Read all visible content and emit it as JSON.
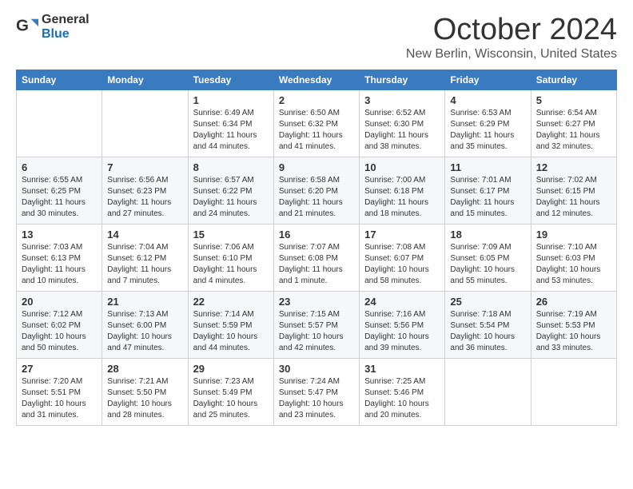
{
  "logo": {
    "general": "General",
    "blue": "Blue"
  },
  "title": "October 2024",
  "subtitle": "New Berlin, Wisconsin, United States",
  "headers": [
    "Sunday",
    "Monday",
    "Tuesday",
    "Wednesday",
    "Thursday",
    "Friday",
    "Saturday"
  ],
  "weeks": [
    [
      {
        "day": "",
        "sunrise": "",
        "sunset": "",
        "daylight": ""
      },
      {
        "day": "",
        "sunrise": "",
        "sunset": "",
        "daylight": ""
      },
      {
        "day": "1",
        "sunrise": "Sunrise: 6:49 AM",
        "sunset": "Sunset: 6:34 PM",
        "daylight": "Daylight: 11 hours and 44 minutes."
      },
      {
        "day": "2",
        "sunrise": "Sunrise: 6:50 AM",
        "sunset": "Sunset: 6:32 PM",
        "daylight": "Daylight: 11 hours and 41 minutes."
      },
      {
        "day": "3",
        "sunrise": "Sunrise: 6:52 AM",
        "sunset": "Sunset: 6:30 PM",
        "daylight": "Daylight: 11 hours and 38 minutes."
      },
      {
        "day": "4",
        "sunrise": "Sunrise: 6:53 AM",
        "sunset": "Sunset: 6:29 PM",
        "daylight": "Daylight: 11 hours and 35 minutes."
      },
      {
        "day": "5",
        "sunrise": "Sunrise: 6:54 AM",
        "sunset": "Sunset: 6:27 PM",
        "daylight": "Daylight: 11 hours and 32 minutes."
      }
    ],
    [
      {
        "day": "6",
        "sunrise": "Sunrise: 6:55 AM",
        "sunset": "Sunset: 6:25 PM",
        "daylight": "Daylight: 11 hours and 30 minutes."
      },
      {
        "day": "7",
        "sunrise": "Sunrise: 6:56 AM",
        "sunset": "Sunset: 6:23 PM",
        "daylight": "Daylight: 11 hours and 27 minutes."
      },
      {
        "day": "8",
        "sunrise": "Sunrise: 6:57 AM",
        "sunset": "Sunset: 6:22 PM",
        "daylight": "Daylight: 11 hours and 24 minutes."
      },
      {
        "day": "9",
        "sunrise": "Sunrise: 6:58 AM",
        "sunset": "Sunset: 6:20 PM",
        "daylight": "Daylight: 11 hours and 21 minutes."
      },
      {
        "day": "10",
        "sunrise": "Sunrise: 7:00 AM",
        "sunset": "Sunset: 6:18 PM",
        "daylight": "Daylight: 11 hours and 18 minutes."
      },
      {
        "day": "11",
        "sunrise": "Sunrise: 7:01 AM",
        "sunset": "Sunset: 6:17 PM",
        "daylight": "Daylight: 11 hours and 15 minutes."
      },
      {
        "day": "12",
        "sunrise": "Sunrise: 7:02 AM",
        "sunset": "Sunset: 6:15 PM",
        "daylight": "Daylight: 11 hours and 12 minutes."
      }
    ],
    [
      {
        "day": "13",
        "sunrise": "Sunrise: 7:03 AM",
        "sunset": "Sunset: 6:13 PM",
        "daylight": "Daylight: 11 hours and 10 minutes."
      },
      {
        "day": "14",
        "sunrise": "Sunrise: 7:04 AM",
        "sunset": "Sunset: 6:12 PM",
        "daylight": "Daylight: 11 hours and 7 minutes."
      },
      {
        "day": "15",
        "sunrise": "Sunrise: 7:06 AM",
        "sunset": "Sunset: 6:10 PM",
        "daylight": "Daylight: 11 hours and 4 minutes."
      },
      {
        "day": "16",
        "sunrise": "Sunrise: 7:07 AM",
        "sunset": "Sunset: 6:08 PM",
        "daylight": "Daylight: 11 hours and 1 minute."
      },
      {
        "day": "17",
        "sunrise": "Sunrise: 7:08 AM",
        "sunset": "Sunset: 6:07 PM",
        "daylight": "Daylight: 10 hours and 58 minutes."
      },
      {
        "day": "18",
        "sunrise": "Sunrise: 7:09 AM",
        "sunset": "Sunset: 6:05 PM",
        "daylight": "Daylight: 10 hours and 55 minutes."
      },
      {
        "day": "19",
        "sunrise": "Sunrise: 7:10 AM",
        "sunset": "Sunset: 6:03 PM",
        "daylight": "Daylight: 10 hours and 53 minutes."
      }
    ],
    [
      {
        "day": "20",
        "sunrise": "Sunrise: 7:12 AM",
        "sunset": "Sunset: 6:02 PM",
        "daylight": "Daylight: 10 hours and 50 minutes."
      },
      {
        "day": "21",
        "sunrise": "Sunrise: 7:13 AM",
        "sunset": "Sunset: 6:00 PM",
        "daylight": "Daylight: 10 hours and 47 minutes."
      },
      {
        "day": "22",
        "sunrise": "Sunrise: 7:14 AM",
        "sunset": "Sunset: 5:59 PM",
        "daylight": "Daylight: 10 hours and 44 minutes."
      },
      {
        "day": "23",
        "sunrise": "Sunrise: 7:15 AM",
        "sunset": "Sunset: 5:57 PM",
        "daylight": "Daylight: 10 hours and 42 minutes."
      },
      {
        "day": "24",
        "sunrise": "Sunrise: 7:16 AM",
        "sunset": "Sunset: 5:56 PM",
        "daylight": "Daylight: 10 hours and 39 minutes."
      },
      {
        "day": "25",
        "sunrise": "Sunrise: 7:18 AM",
        "sunset": "Sunset: 5:54 PM",
        "daylight": "Daylight: 10 hours and 36 minutes."
      },
      {
        "day": "26",
        "sunrise": "Sunrise: 7:19 AM",
        "sunset": "Sunset: 5:53 PM",
        "daylight": "Daylight: 10 hours and 33 minutes."
      }
    ],
    [
      {
        "day": "27",
        "sunrise": "Sunrise: 7:20 AM",
        "sunset": "Sunset: 5:51 PM",
        "daylight": "Daylight: 10 hours and 31 minutes."
      },
      {
        "day": "28",
        "sunrise": "Sunrise: 7:21 AM",
        "sunset": "Sunset: 5:50 PM",
        "daylight": "Daylight: 10 hours and 28 minutes."
      },
      {
        "day": "29",
        "sunrise": "Sunrise: 7:23 AM",
        "sunset": "Sunset: 5:49 PM",
        "daylight": "Daylight: 10 hours and 25 minutes."
      },
      {
        "day": "30",
        "sunrise": "Sunrise: 7:24 AM",
        "sunset": "Sunset: 5:47 PM",
        "daylight": "Daylight: 10 hours and 23 minutes."
      },
      {
        "day": "31",
        "sunrise": "Sunrise: 7:25 AM",
        "sunset": "Sunset: 5:46 PM",
        "daylight": "Daylight: 10 hours and 20 minutes."
      },
      {
        "day": "",
        "sunrise": "",
        "sunset": "",
        "daylight": ""
      },
      {
        "day": "",
        "sunrise": "",
        "sunset": "",
        "daylight": ""
      }
    ]
  ]
}
